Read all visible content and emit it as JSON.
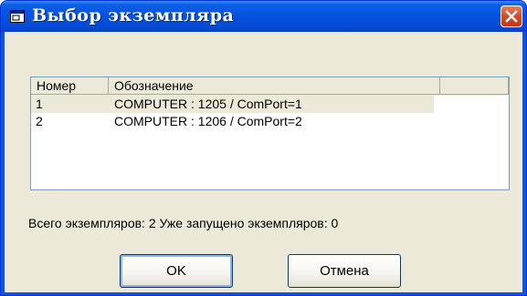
{
  "window": {
    "title": "Выбор экземпляра"
  },
  "list": {
    "columns": [
      "Номер",
      "Обозначение"
    ],
    "rows": [
      {
        "num": "1",
        "name": "COMPUTER : 1205  / ComPort=1",
        "selected": true
      },
      {
        "num": "2",
        "name": "COMPUTER : 1206  / ComPort=2",
        "selected": false
      }
    ]
  },
  "summary": "Всего экземпляров: 2   Уже запущено экземпляров: 0",
  "buttons": {
    "ok": "OK",
    "cancel": "Отмена"
  },
  "colors": {
    "titlebar": "#0651e0",
    "close": "#d6482a",
    "face": "#ece9d8"
  }
}
